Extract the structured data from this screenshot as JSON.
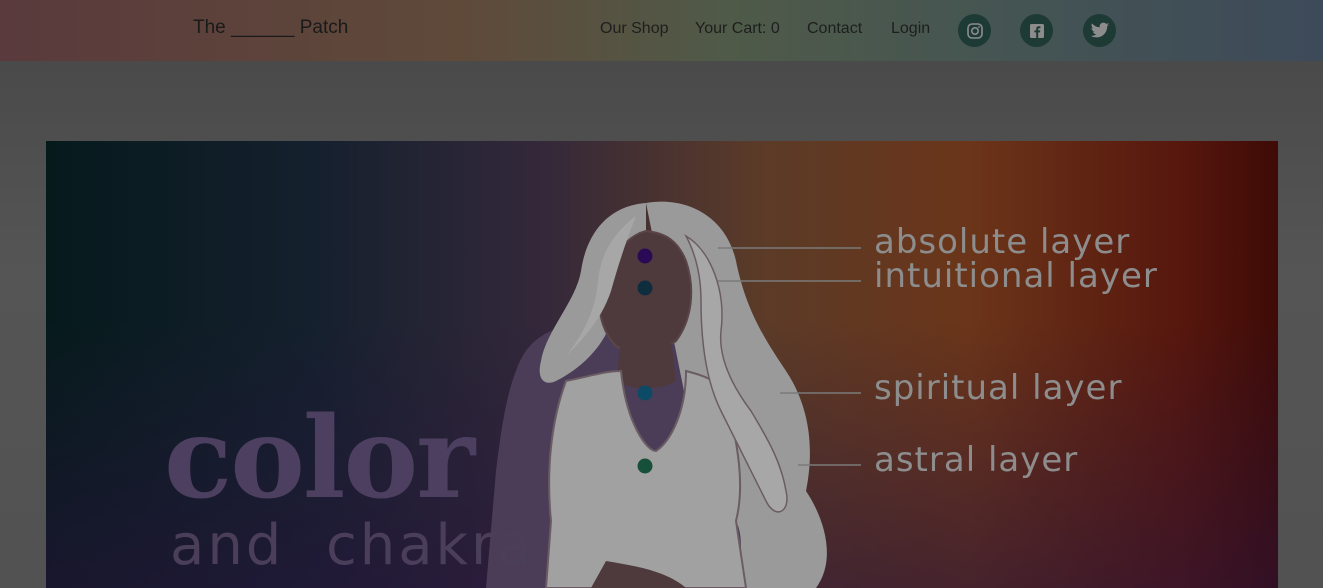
{
  "navbar": {
    "brand": "The ______ Patch",
    "links": {
      "shop": "Our Shop",
      "cart": "Your Cart: 0",
      "contact": "Contact",
      "login": "Login"
    },
    "social": [
      "instagram-icon",
      "facebook-icon",
      "twitter-icon"
    ]
  },
  "hero": {
    "title": "color",
    "subtitle": "and  chakra",
    "layers": [
      {
        "label": "absolute layer",
        "dot_color": "#2a0a55"
      },
      {
        "label": "intuitional layer",
        "dot_color": "#0e2e3e"
      },
      {
        "label": "spiritual layer",
        "dot_color": "#0d4a66"
      },
      {
        "label": "astral layer",
        "dot_color": "#17503a"
      }
    ]
  },
  "colors": {
    "icon_bg": "#1e3a34",
    "label": "#8d8d8d"
  }
}
